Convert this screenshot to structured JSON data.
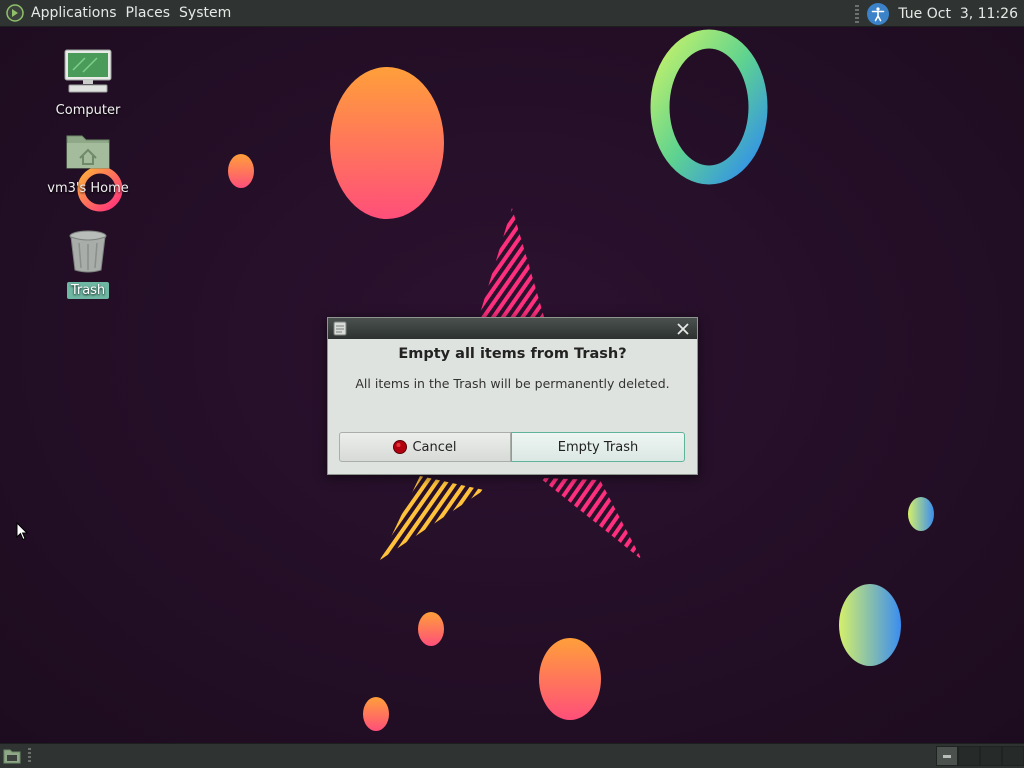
{
  "top_panel": {
    "menu": [
      "Applications",
      "Places",
      "System"
    ],
    "clock": "Tue Oct  3, 11:26"
  },
  "desktop": {
    "icons": [
      {
        "label": "Computer",
        "icon": "computer-icon",
        "selected": false
      },
      {
        "label": "vm3's Home",
        "icon": "home-folder-icon",
        "selected": false
      },
      {
        "label": "Trash",
        "icon": "trash-icon",
        "selected": true
      }
    ]
  },
  "dialog": {
    "heading": "Empty all items from Trash?",
    "message": "All items in the Trash will be permanently deleted.",
    "cancel_label": "Cancel",
    "confirm_label": "Empty Trash"
  },
  "bottom_panel": {
    "workspaces": 4,
    "active_workspace": 1
  },
  "colors": {
    "panel": "#2f3432",
    "desktop_background": "#230f24",
    "accent": "#6eb7a2",
    "dialog_background": "#dfe3df"
  }
}
